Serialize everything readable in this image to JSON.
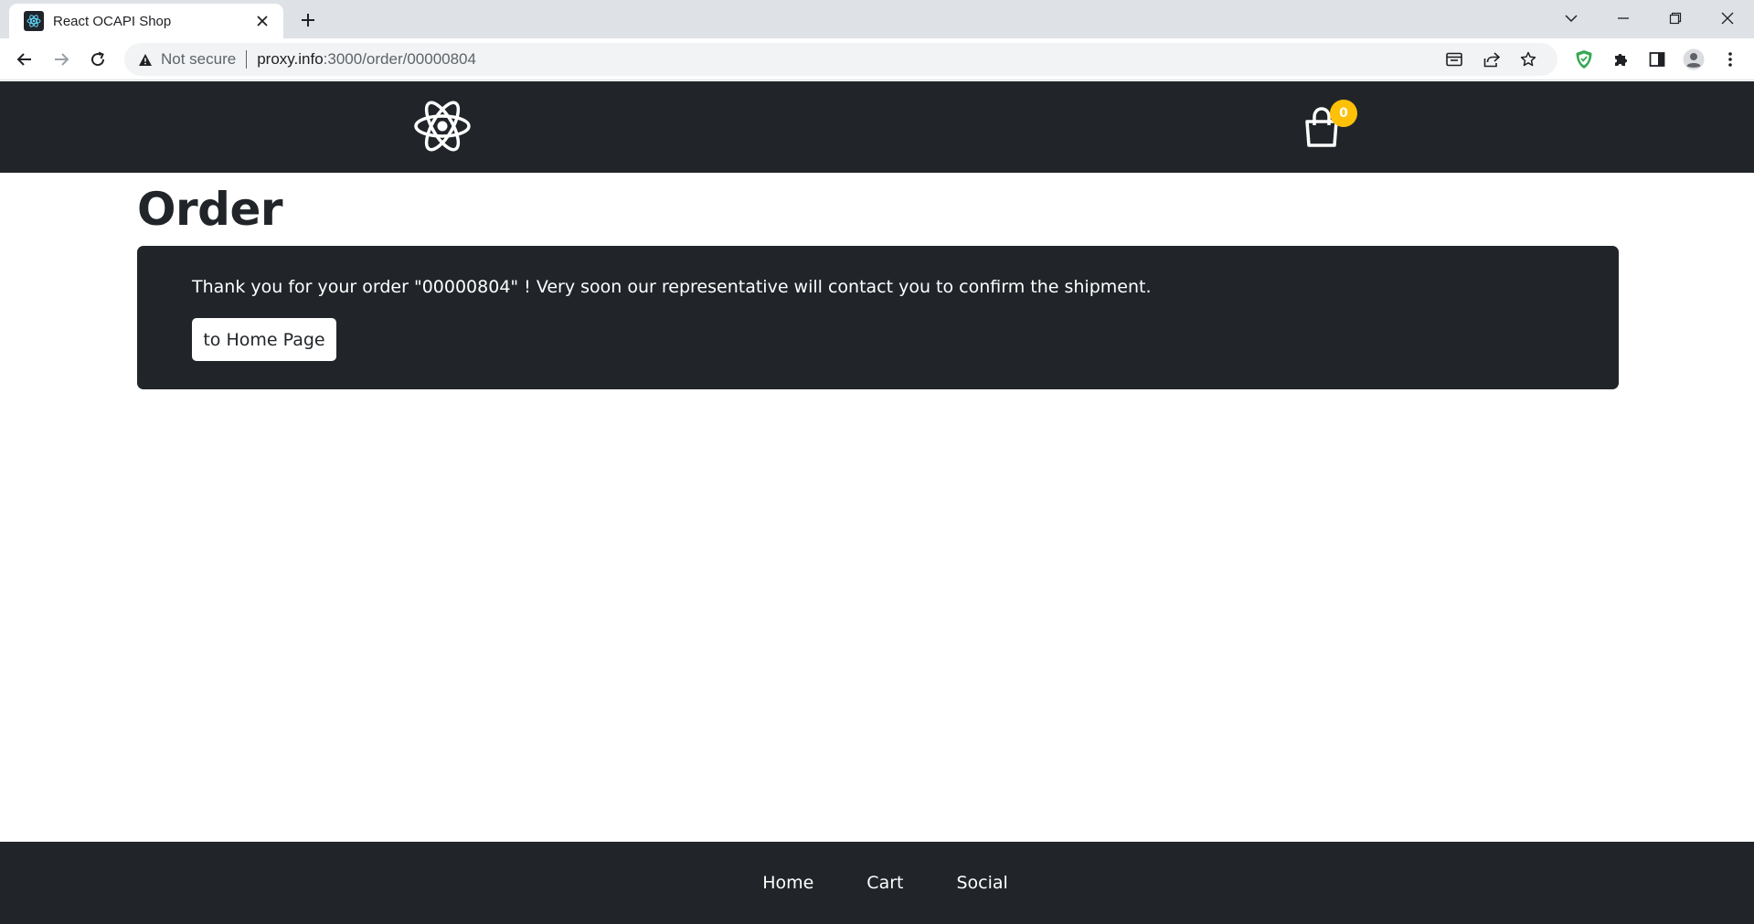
{
  "browser": {
    "tab_title": "React OCAPI Shop",
    "security_label": "Not secure",
    "url_host": "proxy.info",
    "url_path": ":3000/order/00000804",
    "icons": {
      "favicon": "react-logo-icon",
      "close": "close-icon",
      "new_tab": "plus-icon",
      "back": "back-arrow-icon",
      "forward": "forward-arrow-icon",
      "reload": "reload-icon",
      "warning": "warning-icon",
      "install": "install-app-icon",
      "share": "share-icon",
      "bookmark": "star-icon",
      "extension_shield": "shield-extension-icon",
      "extensions": "puzzle-icon",
      "side_panel": "side-panel-icon",
      "profile": "profile-icon",
      "menu": "kebab-menu-icon"
    }
  },
  "header": {
    "logo_icon": "react-logo-icon",
    "cart_icon": "shopping-bag-icon",
    "cart_count": "0"
  },
  "main": {
    "title": "Order",
    "message": "Thank you for your order \"00000804\" ! Very soon our representative will contact you to confirm the shipment.",
    "home_button": "to Home Page"
  },
  "footer": {
    "links": [
      "Home",
      "Cart",
      "Social"
    ]
  },
  "colors": {
    "dark": "#212529",
    "badge": "#ffc107",
    "chrome_bg": "#dee1e6",
    "extension_green": "#34a853"
  }
}
